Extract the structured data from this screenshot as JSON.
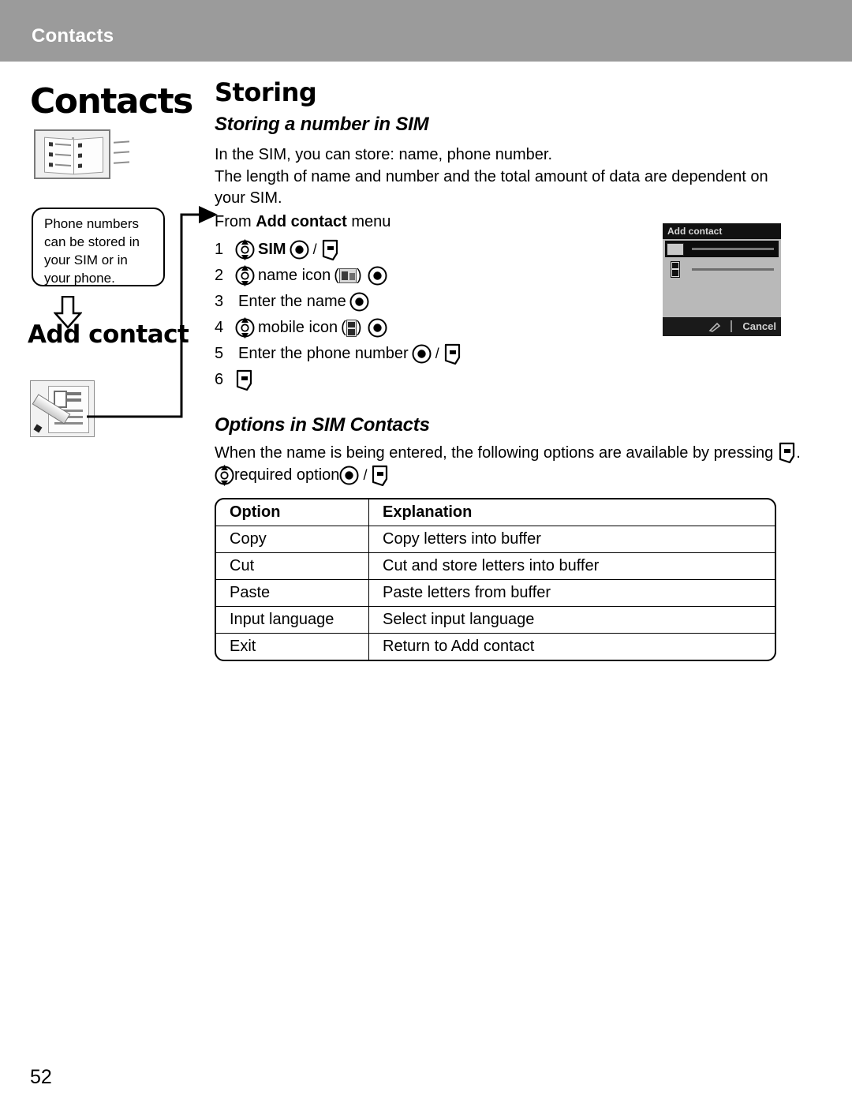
{
  "header": {
    "title": "Contacts",
    "bar_color": "#9b9b9b"
  },
  "sidebar": {
    "chapter_title": "Contacts",
    "book_icon_name": "address-book-icon",
    "callout_text": "Phone numbers can be stored in your SIM or in your phone.",
    "down_arrow_name": "down-arrow-icon",
    "add_contact_label": "Add contact",
    "add_contact_icon_name": "add-contact-icon"
  },
  "main": {
    "section_title": "Storing",
    "subsection_title": "Storing a number in SIM",
    "paragraph_1": "In the SIM, you can store: name, phone number.",
    "paragraph_2": "The length of name and number and the total amount of data are dependent on your SIM.",
    "from_prefix": "From ",
    "from_bold": "Add contact",
    "from_suffix": " menu",
    "steps": [
      {
        "num": "1",
        "label": "SIM",
        "bold": true
      },
      {
        "num": "2",
        "label": "name icon"
      },
      {
        "num": "3",
        "label": "Enter the name"
      },
      {
        "num": "4",
        "label": "mobile icon"
      },
      {
        "num": "5",
        "label": "Enter the phone number"
      },
      {
        "num": "6",
        "label": ""
      }
    ],
    "separator": "/",
    "paren_open": "(",
    "paren_close": ")"
  },
  "phone_screenshot": {
    "title": "Add contact",
    "softkey_left_icon": "pencil-icon",
    "softkey_right_label": "Cancel"
  },
  "options": {
    "title": "Options in SIM Contacts",
    "intro": "When the name is being entered, the following options are available by pressing",
    "intro_end": ".",
    "select_line": "required option",
    "table": {
      "headers": [
        "Option",
        "Explanation"
      ],
      "rows": [
        [
          "Copy",
          "Copy letters into buffer"
        ],
        [
          "Cut",
          "Cut and store letters into buffer"
        ],
        [
          "Paste",
          "Paste letters from buffer"
        ],
        [
          "Input language",
          "Select input language"
        ],
        [
          "Exit",
          "Return to Add contact"
        ]
      ]
    }
  },
  "footer": {
    "page_number": "52"
  }
}
